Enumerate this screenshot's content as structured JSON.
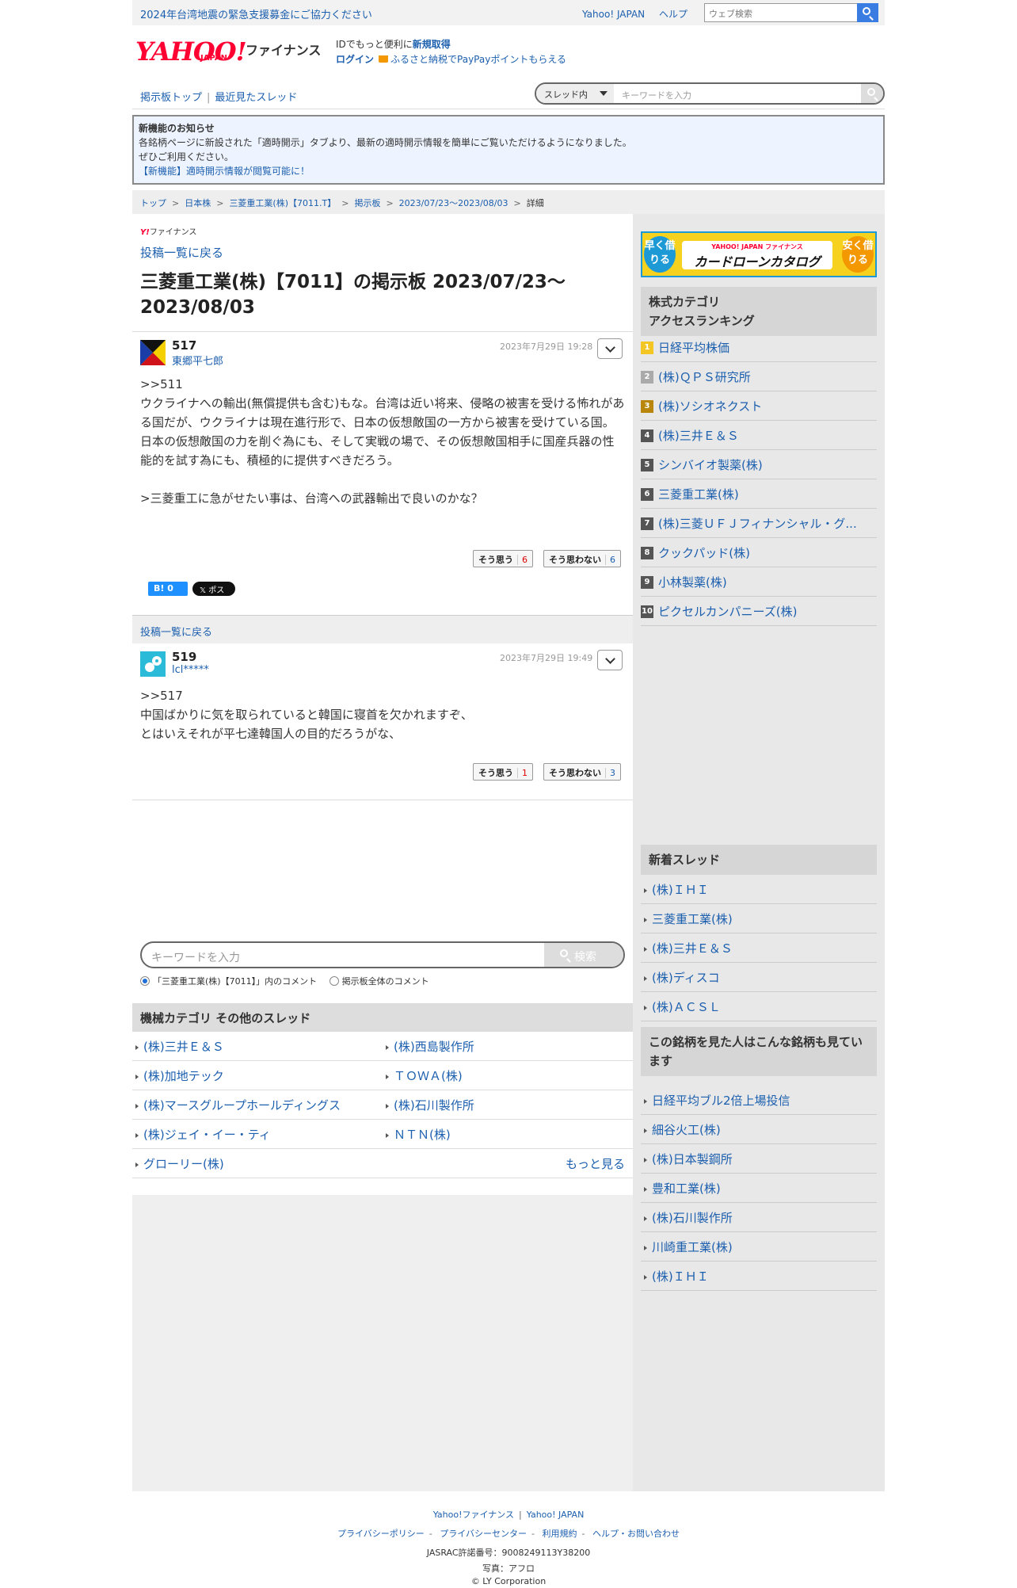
{
  "topbar": {
    "notice": "2024年台湾地震の緊急支援募金にご協力ください",
    "yahoo_japan": "Yahoo! JAPAN",
    "help": "ヘルプ",
    "web_search_placeholder": "ウェブ検索"
  },
  "header": {
    "logo": "YAHOO!",
    "logo_sub": "JAPAN",
    "finance": "ファイナンス",
    "id_text": "IDでもっと便利に",
    "signup": "新規取得",
    "login": "ログイン",
    "furusato": "ふるさと納税でPayPayポイントもらえる"
  },
  "subnav": {
    "board_top": "掲示板トップ",
    "recent": "最近見たスレッド",
    "scope": "スレッド内",
    "placeholder": "キーワードを入力"
  },
  "news": {
    "title": "新機能のお知らせ",
    "line1": "各銘柄ページに新設された「適時開示」タブより、最新の適時開示情報を簡単にご覧いただけるようになりました。",
    "line2": "ぜひご利用ください。",
    "link": "【新機能】適時開示情報が閲覧可能に！"
  },
  "breadcrumb": [
    "トップ",
    "日本株",
    "三菱重工業(株)【7011.T】",
    "掲示板",
    "2023/07/23〜2023/08/03",
    "詳細"
  ],
  "main": {
    "fin_logo_y": "Y!",
    "fin_logo_text": "ファイナンス",
    "back": "投稿一覧に戻る",
    "title": "三菱重工業(株)【7011】の掲示板 2023/07/23〜2023/08/03"
  },
  "posts": [
    {
      "number": "517",
      "user": "東郷平七郎",
      "date": "2023年7月29日 19:28",
      "reply": ">>511",
      "body": "ウクライナへの輸出(無償提供も含む)もな。台湾は近い将来、侵略の被害を受ける怖れがある国だが、ウクライナは現在進行形で、日本の仮想敵国の一方から被害を受けている国。\n日本の仮想敵国の力を削ぐ為にも、そして実戦の場で、その仮想敵国相手に国産兵器の性能的を試す為にも、積極的に提供すべきだろう。\n\n>三菱重工に急がせたい事は、台湾への武器輸出で良いのかな？",
      "agree_label": "そう思う",
      "agree": "6",
      "disagree_label": "そう思わない",
      "disagree": "6",
      "hatena": "B! 0",
      "x_label": "𝕏 ポスト"
    },
    {
      "number": "519",
      "user": "lcl*****",
      "date": "2023年7月29日 19:49",
      "reply": ">>517",
      "body": "中国ばかりに気を取られていると韓国に寝首を欠かれますぞ、\nとはいえそれが平七達韓国人の目的だろうがな、",
      "agree_label": "そう思う",
      "agree": "1",
      "disagree_label": "そう思わない",
      "disagree": "3"
    }
  ],
  "back_bar": "投稿一覧に戻る",
  "keyword_search": {
    "placeholder": "キーワードを入力",
    "button": "検索",
    "radio1": "「三菱重工業(株)【7011】」内のコメント",
    "radio2": "掲示板全体のコメント"
  },
  "category": {
    "title": "機械カテゴリ  その他のスレッド",
    "items": [
      "(株)三井Ｅ＆Ｓ",
      "(株)西島製作所",
      "(株)加地テック",
      "ＴＯＷＡ(株)",
      "(株)マースグループホールディングス",
      "(株)石川製作所",
      "(株)ジェイ・イー・ティ",
      "ＮＴＮ(株)",
      "グローリー(株)"
    ],
    "more": "もっと見る"
  },
  "ad": {
    "left": "早く借りる",
    "right": "安く借りる",
    "top": "YAHOO! JAPAN ファイナンス",
    "main": "カードローンカタログ"
  },
  "ranking": {
    "title_l1": "株式カテゴリ",
    "title_l2": "アクセスランキング",
    "items": [
      "日経平均株価",
      "(株)ＱＰＳ研究所",
      "(株)ソシオネクスト",
      "(株)三井Ｅ＆Ｓ",
      "シンバイオ製薬(株)",
      "三菱重工業(株)",
      "(株)三菱ＵＦＪフィナンシャル・グ...",
      "クックパッド(株)",
      "小林製薬(株)",
      "ピクセルカンパニーズ(株)"
    ],
    "ranks": [
      "1",
      "2",
      "3",
      "4",
      "5",
      "6",
      "7",
      "8",
      "9",
      "10"
    ],
    "rank_colors": [
      "#f3c623",
      "#aaaaaa",
      "#b8860b",
      "#555555",
      "#555555",
      "#555555",
      "#555555",
      "#555555",
      "#555555",
      "#555555"
    ]
  },
  "new_threads": {
    "title": "新着スレッド",
    "items": [
      "(株)ＩＨＩ",
      "三菱重工業(株)",
      "(株)三井Ｅ＆Ｓ",
      "(株)ディスコ",
      "(株)ＡＣＳＬ"
    ]
  },
  "also_viewed": {
    "title": "この銘柄を見た人はこんな銘柄も見ています",
    "items": [
      "日経平均ブル2倍上場投信",
      "細谷火工(株)",
      "(株)日本製鋼所",
      "豊和工業(株)",
      "(株)石川製作所",
      "川崎重工業(株)",
      "(株)ＩＨＩ"
    ]
  },
  "footer": {
    "l1a": "Yahoo!ファイナンス",
    "l1b": "Yahoo! JAPAN",
    "l2": [
      "プライバシーポリシー",
      "プライバシーセンター",
      "利用規約",
      "ヘルプ・お問い合わせ"
    ],
    "jasrac": "JASRAC許諾番号：9008249113Y38200",
    "photo": "写真：アフロ",
    "copyright": "© LY Corporation"
  }
}
